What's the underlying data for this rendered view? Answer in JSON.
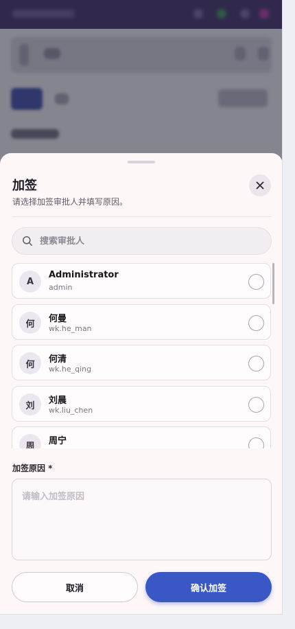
{
  "colors": {
    "primary": "#3a57c6",
    "sheet_bg": "#fdf7f8",
    "header_bg": "#3b2a66"
  },
  "sheet": {
    "title": "加签",
    "subtitle": "请选择加签审批人并填写原因。",
    "close_icon": "close-icon"
  },
  "search": {
    "placeholder": "搜索审批人",
    "value": ""
  },
  "approvers": [
    {
      "avatar": "A",
      "name": "Administrator",
      "id": "admin"
    },
    {
      "avatar": "何",
      "name": "何曼",
      "id": "wk.he_man"
    },
    {
      "avatar": "何",
      "name": "何清",
      "id": "wk.he_qing"
    },
    {
      "avatar": "刘",
      "name": "刘晨",
      "id": "wk.liu_chen"
    },
    {
      "avatar": "周",
      "name": "周宁",
      "id": ""
    }
  ],
  "reason": {
    "label": "加签原因 *",
    "placeholder": "请输入加签原因"
  },
  "actions": {
    "cancel_label": "取消",
    "confirm_label": "确认加签"
  }
}
